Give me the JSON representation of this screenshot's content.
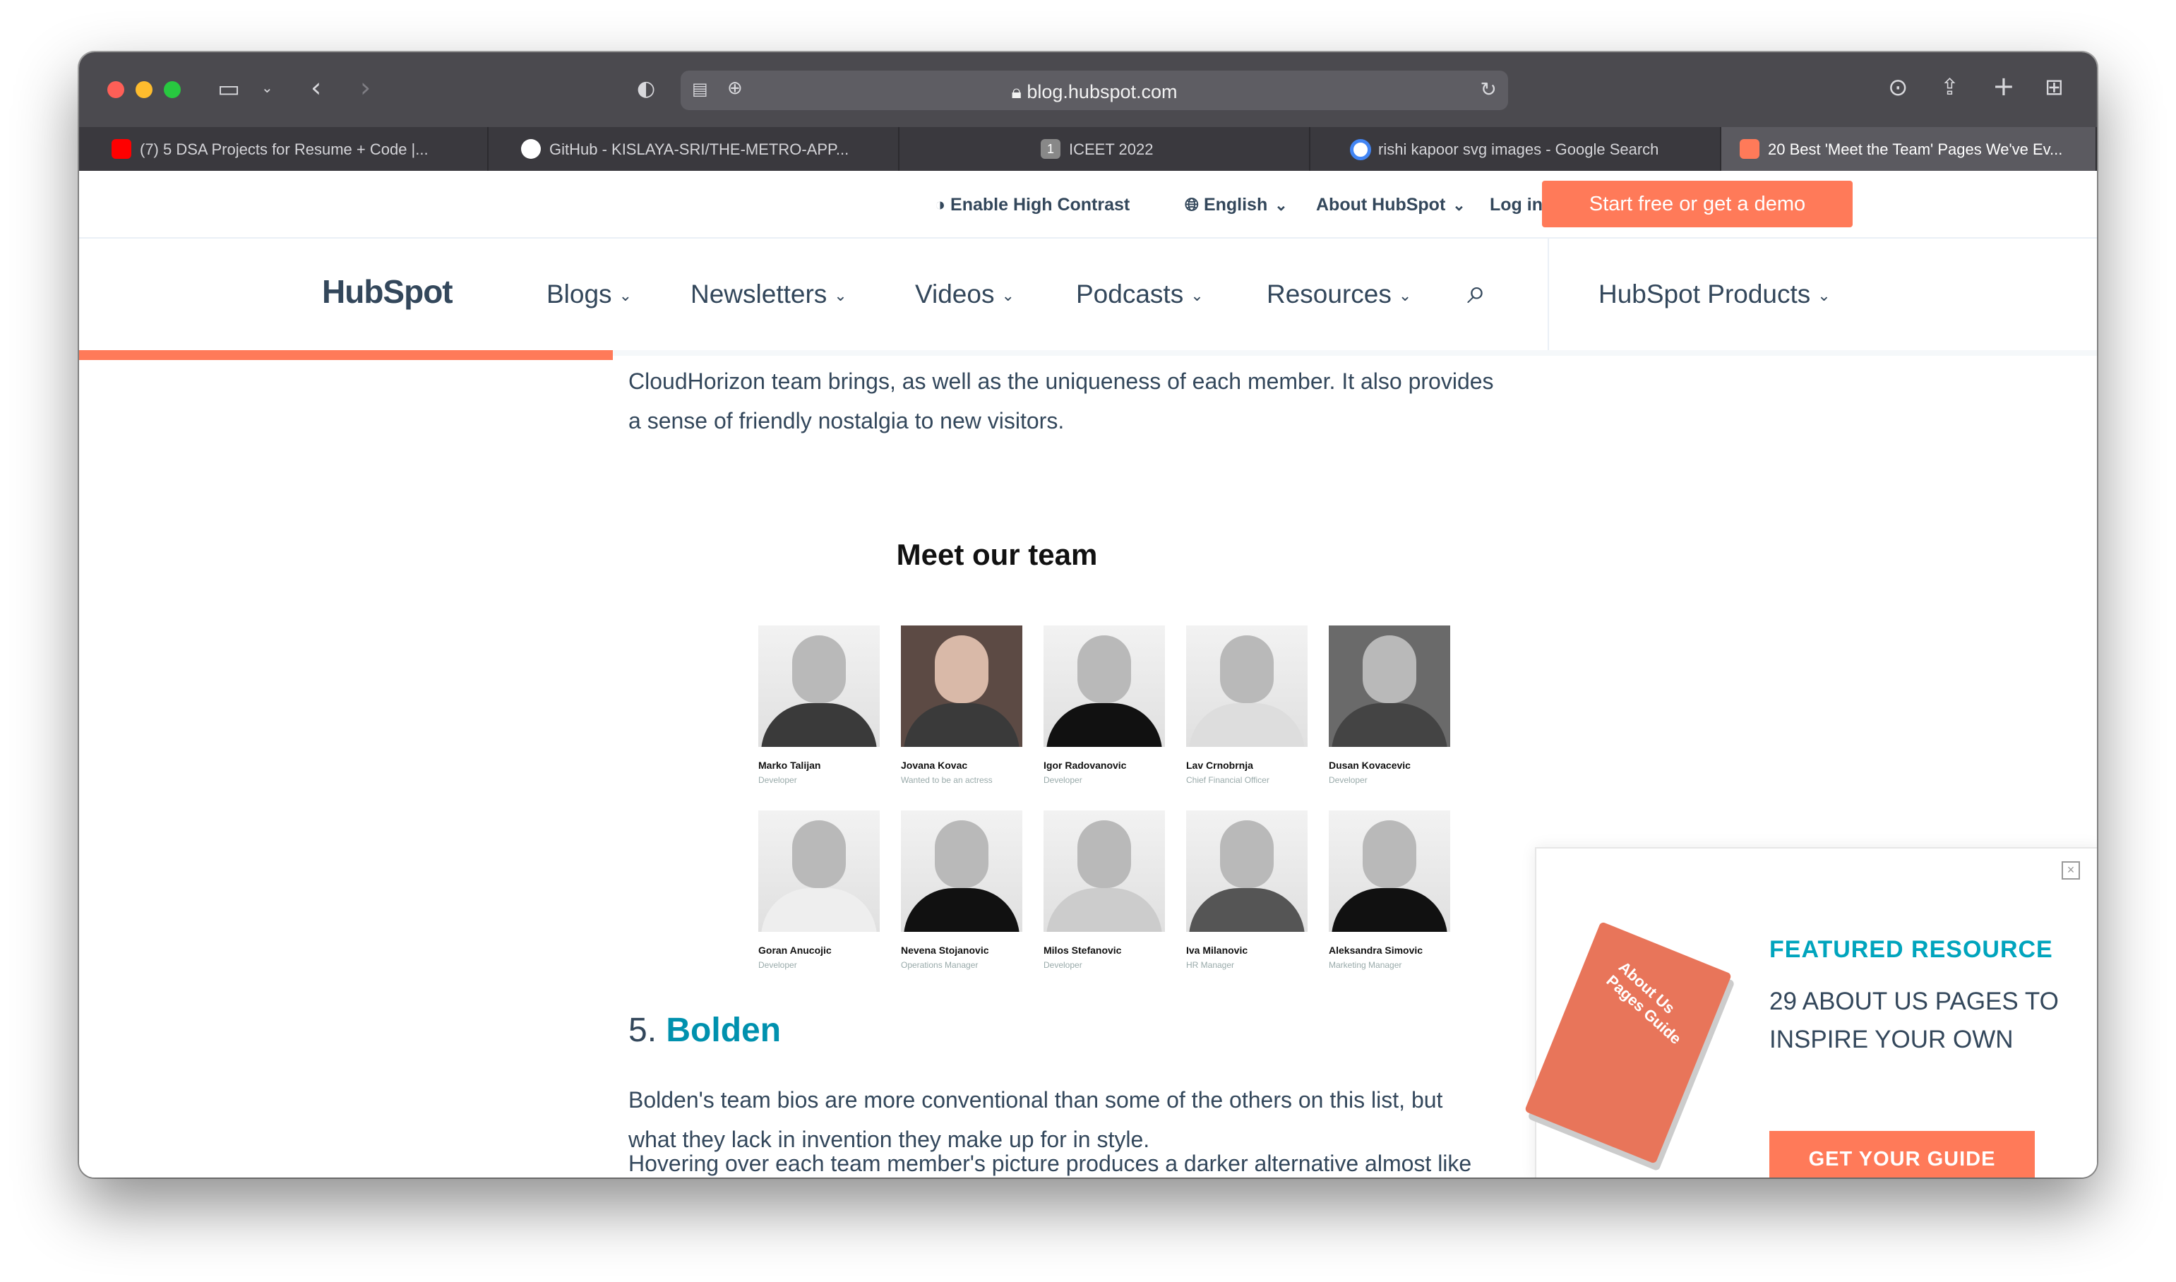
{
  "browser": {
    "url": "blog.hubspot.com",
    "tabs": [
      {
        "label": "(7) 5 DSA Projects for Resume + Code |...",
        "icon": "youtube-icon",
        "color": "#ff0000"
      },
      {
        "label": "GitHub - KISLAYA-SRI/THE-METRO-APP...",
        "icon": "github-icon",
        "color": "#ffffff"
      },
      {
        "label": "ICEET 2022",
        "icon": "page-number-icon",
        "color": "#888888",
        "glyph": "1"
      },
      {
        "label": "rishi kapoor svg images - Google Search",
        "icon": "google-icon",
        "color": "#4285f4"
      },
      {
        "label": "20 Best 'Meet the Team' Pages We've Ev...",
        "icon": "hubspot-icon",
        "color": "#ff7a59"
      }
    ]
  },
  "utility": {
    "contrast": "Enable High Contrast",
    "language": "English",
    "about": "About HubSpot",
    "login": "Log in",
    "cta": "Start free or get a demo"
  },
  "nav": {
    "logo": "HubSpot",
    "items": [
      "Blogs",
      "Newsletters",
      "Videos",
      "Podcasts",
      "Resources"
    ],
    "products": "HubSpot Products"
  },
  "article": {
    "intro_line1": "CloudHorizon team brings, as well as the uniqueness of each member. It also provides",
    "intro_line2": "a sense of friendly nostalgia to new visitors.",
    "team_title": "Meet our team",
    "members": [
      {
        "name": "Marko Talijan",
        "role": "Developer"
      },
      {
        "name": "Jovana Kovac",
        "role": "Wanted to be an actress"
      },
      {
        "name": "Igor Radovanovic",
        "role": "Developer"
      },
      {
        "name": "Lav Crnobrnja",
        "role": "Chief Financial Officer"
      },
      {
        "name": "Dusan Kovacevic",
        "role": "Developer"
      },
      {
        "name": "Goran Anucojic",
        "role": "Developer"
      },
      {
        "name": "Nevena Stojanovic",
        "role": "Operations Manager"
      },
      {
        "name": "Milos Stefanovic",
        "role": "Developer"
      },
      {
        "name": "Iva Milanovic",
        "role": "HR Manager"
      },
      {
        "name": "Aleksandra Simovic",
        "role": "Marketing Manager"
      }
    ],
    "section_number": "5.",
    "section_link": "Bolden",
    "p1_line1": "Bolden's team bios are more conventional than some of the others on this list, but",
    "p1_line2": "what they lack in invention they make up for in style.",
    "p2_line1": "Hovering over each team member's picture produces a darker alternative almost like"
  },
  "popup": {
    "label": "FEATURED RESOURCE",
    "headline": "29 ABOUT US PAGES TO INSPIRE YOUR OWN",
    "button": "GET YOUR GUIDE",
    "book_title": "About Us Pages Guide"
  },
  "colors": {
    "accent": "#ff7a59",
    "text": "#33475b",
    "teal": "#00a4bd"
  }
}
